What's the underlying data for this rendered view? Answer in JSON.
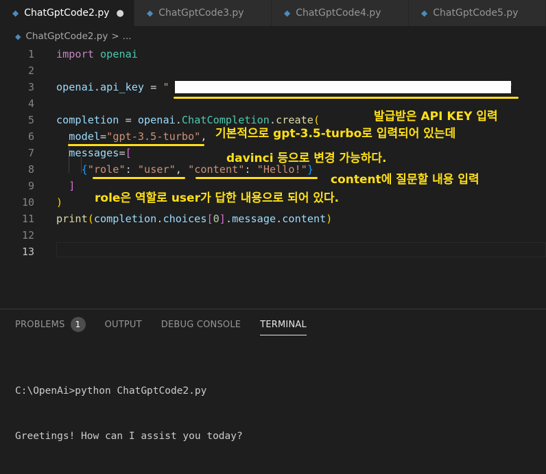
{
  "tabs": [
    {
      "label": "ChatGptCode2.py",
      "active": true,
      "modified_dot": "●"
    },
    {
      "label": "ChatGptCode3.py",
      "active": false
    },
    {
      "label": "ChatGptCode4.py",
      "active": false
    },
    {
      "label": "ChatGptCode5.py",
      "active": false
    }
  ],
  "breadcrumb": {
    "file": "ChatGptCode2.py",
    "sep": ">",
    "more": "..."
  },
  "line_numbers": [
    "1",
    "2",
    "3",
    "4",
    "5",
    "6",
    "7",
    "8",
    "9",
    "10",
    "11",
    "12",
    "13"
  ],
  "code": {
    "l1_kw": "import",
    "l1_mod": "openai",
    "l3_obj": "openai",
    "l3_dot": ".",
    "l3_attr": "api_key",
    "l3_eq": " = ",
    "l3_q1": "\"",
    "l3_q2": "\"",
    "l5_var": "completion",
    "l5_eq": " = ",
    "l5_obj": "openai",
    "l5_d1": ".",
    "l5_cls": "ChatCompletion",
    "l5_d2": ".",
    "l5_fn": "create",
    "l5_paren": "(",
    "l6_param": "model",
    "l6_eq": "=",
    "l6_str": "\"gpt-3.5-turbo\"",
    "l6_comma": ",",
    "l7_param": "messages",
    "l7_eq": "=",
    "l7_br": "[",
    "l8_br": "{",
    "l8_k1": "\"role\"",
    "l8_c1": ": ",
    "l8_v1": "\"user\"",
    "l8_s": ", ",
    "l8_k2": "\"content\"",
    "l8_c2": ": ",
    "l8_v2": "\"Hello!\"",
    "l8_br2": "}",
    "l9_br": "]",
    "l10_paren": ")",
    "l11_fn": "print",
    "l11_p1": "(",
    "l11_obj": "completion",
    "l11_d1": ".",
    "l11_a1": "choices",
    "l11_b1": "[",
    "l11_num": "0",
    "l11_b2": "]",
    "l11_d2": ".",
    "l11_a2": "message",
    "l11_d3": ".",
    "l11_a3": "content",
    "l11_p2": ")"
  },
  "annotations": {
    "api_key": "발급받은 API KEY 입력",
    "model": "기본적으로 gpt-3.5-turbo로 입력되어 있는데",
    "davinci": "davinci 등으로 변경 가능하다.",
    "content": "content에 질문할 내용 입력",
    "role": "role은 역할로 user가 답한 내용으로 되어 있다."
  },
  "annotation_color": "#ffe018",
  "panel": {
    "tabs": [
      "PROBLEMS",
      "OUTPUT",
      "DEBUG CONSOLE",
      "TERMINAL"
    ],
    "problems_count": "1",
    "active_tab": "TERMINAL"
  },
  "terminal": {
    "line1": "C:\\OpenAi>python ChatGptCode2.py",
    "line2": "Greetings! How can I assist you today?"
  }
}
